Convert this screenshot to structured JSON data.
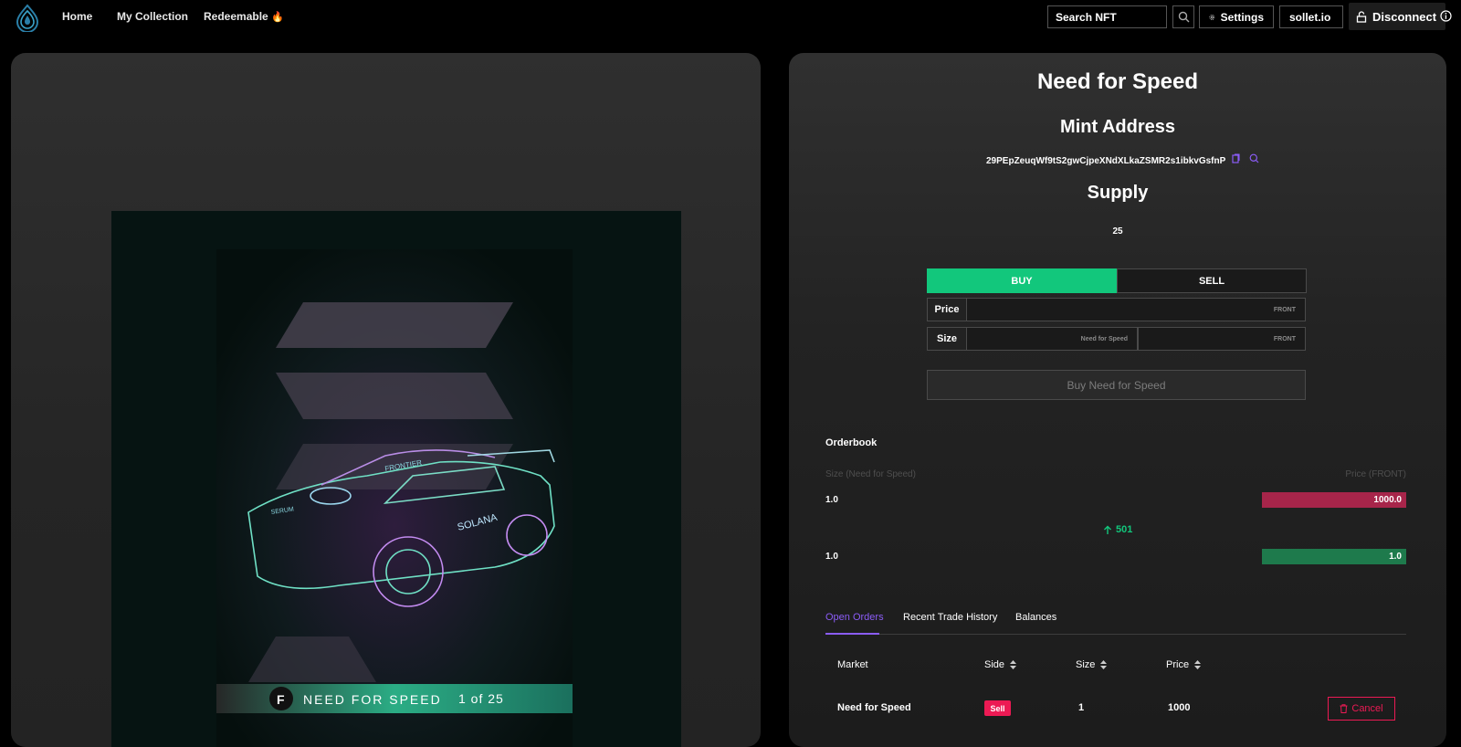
{
  "nav": {
    "links": [
      "Home",
      "My Collection",
      "Redeemable"
    ],
    "redeemable_emoji": "🔥",
    "search_placeholder": "Search NFT",
    "settings_label": "Settings",
    "wallet_label": "sollet.io",
    "disconnect_label": "Disconnect"
  },
  "nft": {
    "card_title": "NEED FOR SPEED",
    "card_edition": "1 of 25"
  },
  "details": {
    "title": "Need for Speed",
    "mint_heading": "Mint Address",
    "mint_address": "29PEpZeuqWf9tS2gwCjpeXNdXLkaZSMR2s1ibkvGsfnP",
    "supply_heading": "Supply",
    "supply_value": "25"
  },
  "trade": {
    "buy_label": "BUY",
    "sell_label": "SELL",
    "price_label": "Price",
    "price_unit": "FRONT",
    "size_label": "Size",
    "size_unit": "Need for Speed",
    "size_total_unit": "FRONT",
    "submit_label": "Buy Need for Speed"
  },
  "orderbook": {
    "title": "Orderbook",
    "size_header": "Size (Need for Speed)",
    "price_header": "Price (FRONT)",
    "ask": {
      "size": "1.0",
      "price": "1000.0"
    },
    "spread": "501",
    "bid": {
      "size": "1.0",
      "price": "1.0"
    }
  },
  "orders": {
    "tabs": [
      "Open Orders",
      "Recent Trade History",
      "Balances"
    ],
    "columns": [
      "Market",
      "Side",
      "Size",
      "Price"
    ],
    "rows": [
      {
        "market": "Need for Speed",
        "side": "Sell",
        "size": "1",
        "price": "1000",
        "action": "Cancel"
      }
    ]
  },
  "colors": {
    "buy_green": "#12c77c",
    "ask_red": "#a7254a",
    "bid_green": "#1e7a4c",
    "accent_purple": "#8b5cf6",
    "sell_pink": "#ec1a54"
  }
}
